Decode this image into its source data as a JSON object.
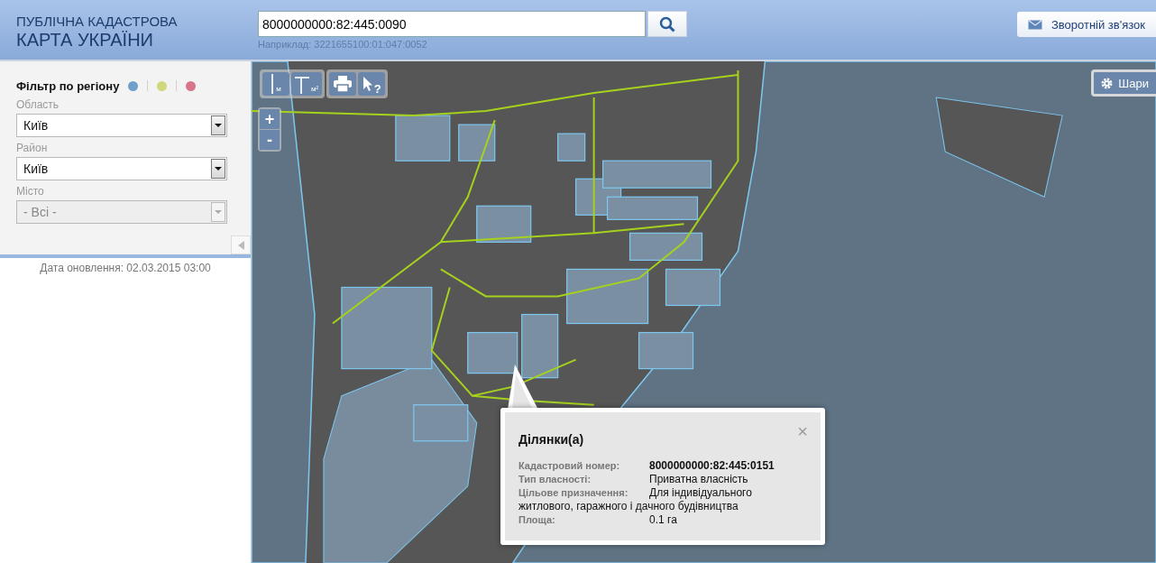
{
  "header": {
    "title_line1": "ПУБЛІЧНА КАДАСТРОВА",
    "title_line2": "КАРТА УКРАЇНИ",
    "search": {
      "value": "8000000000:82:445:0090"
    },
    "example": "Наприклад: 3221655100:01:047:0052",
    "feedback_button": "Зворотній зв'язок"
  },
  "sidebar": {
    "filter_title": "Фільтр по регіону",
    "region_dots": [
      {
        "color": "#6fa0cc"
      },
      {
        "color": "#cfd87a"
      },
      {
        "color": "#d8758a"
      }
    ],
    "fields": [
      {
        "label": "Область",
        "value": "Київ",
        "disabled": false
      },
      {
        "label": "Район",
        "value": "Київ",
        "disabled": false
      },
      {
        "label": "Місто",
        "value": "- Всі -",
        "disabled": true
      }
    ],
    "update_date": "Дата оновлення: 02.03.2015 03:00"
  },
  "map_tools": [
    {
      "kind": "length",
      "unit": "м"
    },
    {
      "kind": "area",
      "unit": "м²"
    },
    {
      "kind": "print"
    },
    {
      "kind": "identify",
      "label": "?"
    }
  ],
  "zoom": [
    "+",
    "-"
  ],
  "layers_button": "Шари",
  "popup": {
    "title": "Ділянки(а)",
    "close": "×",
    "rows": [
      {
        "label": "Кадастровий номер:",
        "value": "8000000000:82:445:0151",
        "kind": "bold"
      },
      {
        "label": "Тип власності:",
        "value": "Приватна власність",
        "kind": "plain"
      },
      {
        "label": "Цільове призначення:",
        "value": "Для індивідуального",
        "continuation": "житлового, гаражного і дачного будівництва",
        "kind": "plain"
      },
      {
        "label": "Площа:",
        "value": "0.1 га",
        "kind": "plain"
      }
    ]
  }
}
